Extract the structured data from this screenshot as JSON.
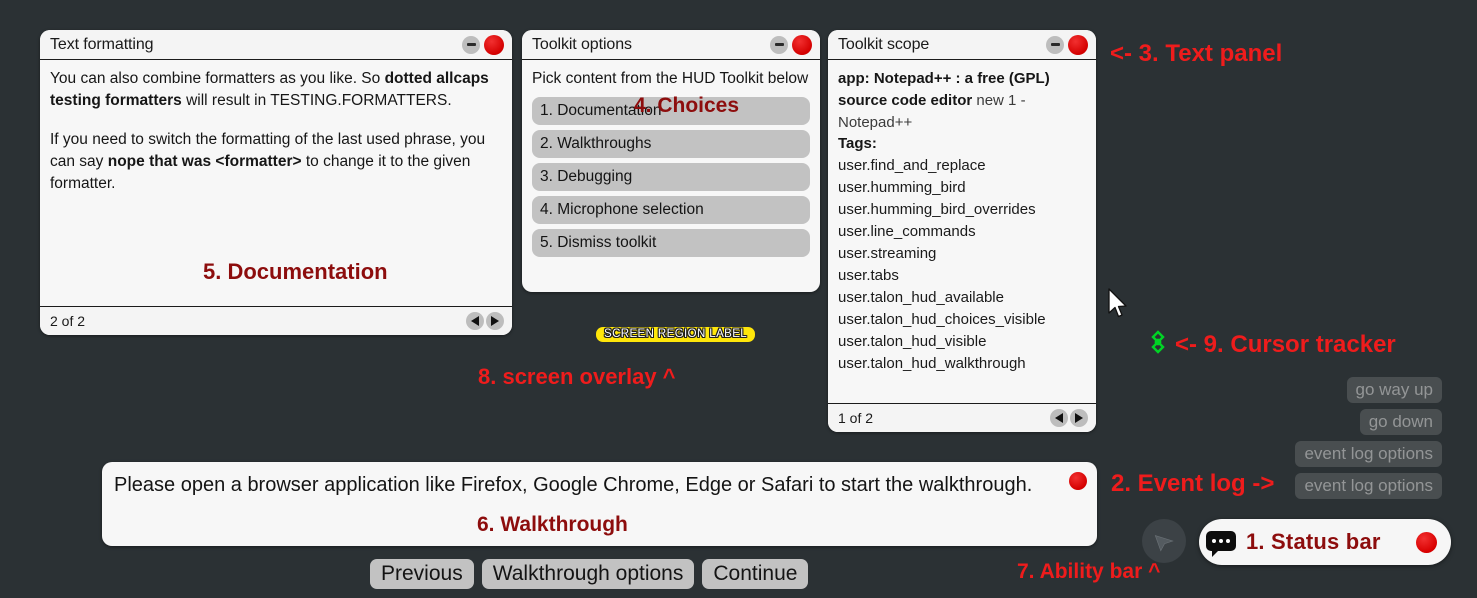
{
  "background_color": "#2b3134",
  "annotation_color": "#ef1c1c",
  "annotation_dark_color": "#8d0d0d",
  "text_panel": {
    "title": "Text formatting",
    "minimize_icon": "minus-circle-icon",
    "close_icon": "close-circle-icon",
    "paragraph_1_part_1": "You can also combine formatters as you like. So ",
    "paragraph_1_bold": "dotted allcaps testing formatters",
    "paragraph_1_part_2": " will result in TESTING.FORMATTERS.",
    "paragraph_2_part_1": "If you need to switch the formatting of the last used phrase, you can say ",
    "paragraph_2_bold": "nope that was <formatter>",
    "paragraph_2_part_2": " to change it to the given formatter.",
    "page_indicator": "2 of 2",
    "prev_icon": "triangle-left-icon",
    "next_icon": "triangle-right-icon"
  },
  "choice_panel": {
    "title": "Toolkit options",
    "intro": "Pick content from the HUD Toolkit below",
    "choices": [
      "1. Documentation",
      "2. Walkthroughs",
      "3. Debugging",
      "4. Microphone selection",
      "5. Dismiss toolkit"
    ]
  },
  "scope_panel": {
    "title": "Toolkit scope",
    "app_label_bold_1": "app: Notepad++ : a free (GPL) source code editor",
    "app_label_muted": " new 1 - Notepad++",
    "tags_label": "Tags:",
    "tags": [
      "user.find_and_replace",
      "user.humming_bird",
      "user.humming_bird_overrides",
      "user.line_commands",
      "user.streaming",
      "user.tabs",
      "user.talon_hud_available",
      "user.talon_hud_choices_visible",
      "user.talon_hud_visible",
      "user.talon_hud_walkthrough"
    ],
    "page_indicator": "1 of 2"
  },
  "walkthrough": {
    "message": "Please open a browser application like Firefox, Google Chrome, Edge or Safari to start the walkthrough.",
    "close_icon": "close-circle-icon",
    "buttons": [
      "Previous",
      "Walkthrough options",
      "Continue"
    ]
  },
  "event_log": {
    "buttons": [
      "go way up",
      "go down",
      "event log options",
      "event log options"
    ]
  },
  "status_bar": {
    "speech_icon": "speech-bubble-icon",
    "label": "1. Status bar",
    "indicator_icon": "red-dot-icon",
    "indicator_color": "#d80000"
  },
  "ability_bar": {
    "icon": "cursor-arrow-icon"
  },
  "screen_overlay": {
    "region_label": "SCREEN REGION LABEL",
    "background_color": "#ffe60a"
  },
  "cursor_tracker": {
    "icon": "green-diamond-crosshair-icon",
    "color": "#00d425"
  },
  "mouse_pointer": {
    "icon": "mouse-pointer-icon"
  },
  "annotations": {
    "text_panel": "<- 3. Text panel",
    "choices": "4. Choices",
    "documentation": "5. Documentation",
    "screen_overlay": "8. screen overlay ^",
    "cursor_tracker": "<- 9. Cursor tracker",
    "event_log": "2. Event log ->",
    "walkthrough": "6. Walkthrough",
    "ability_bar": "7. Ability bar ^"
  }
}
